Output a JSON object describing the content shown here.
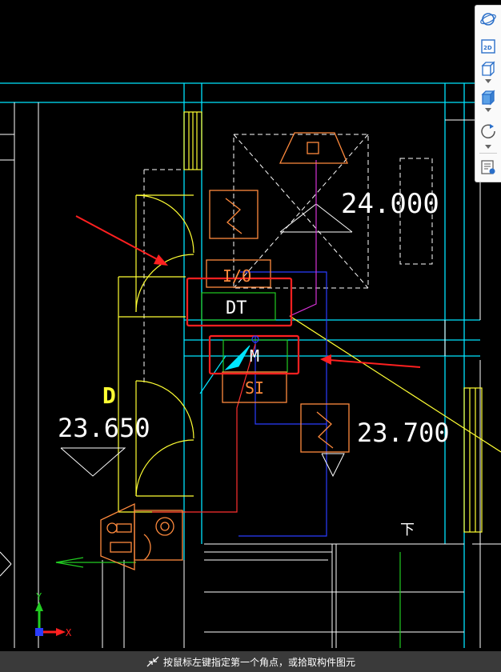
{
  "drawing": {
    "labels": {
      "elev_top_right": "24.000",
      "elev_left": "23.650",
      "elev_right": "23.700",
      "io_box": "I/O",
      "dt_box": "DT",
      "m_box": "M",
      "si_box": "SI",
      "room_letter": "D",
      "small_t": "下"
    },
    "axis": {
      "y": "Y",
      "x": "X"
    },
    "colors": {
      "grid": "#00e5ff",
      "wall": "#ffffff",
      "door": "#ffff33",
      "equipment": "#ff8a3d",
      "selection": "#ff2020",
      "pipe_red": "#ff3030",
      "pipe_blue": "#2a3cff",
      "pipe_magenta": "#d633d6",
      "highlight_green": "#22cc22"
    }
  },
  "toolbar": {
    "items": [
      {
        "name": "orbit-icon"
      },
      {
        "name": "2d-view-icon",
        "text": "2D"
      },
      {
        "name": "3d-box-icon"
      },
      {
        "name": "solid-box-icon"
      },
      {
        "name": "rotate-icon"
      },
      {
        "name": "properties-icon"
      }
    ]
  },
  "status": {
    "message": "按鼠标左键指定第一个角点，或拾取构件图元"
  }
}
